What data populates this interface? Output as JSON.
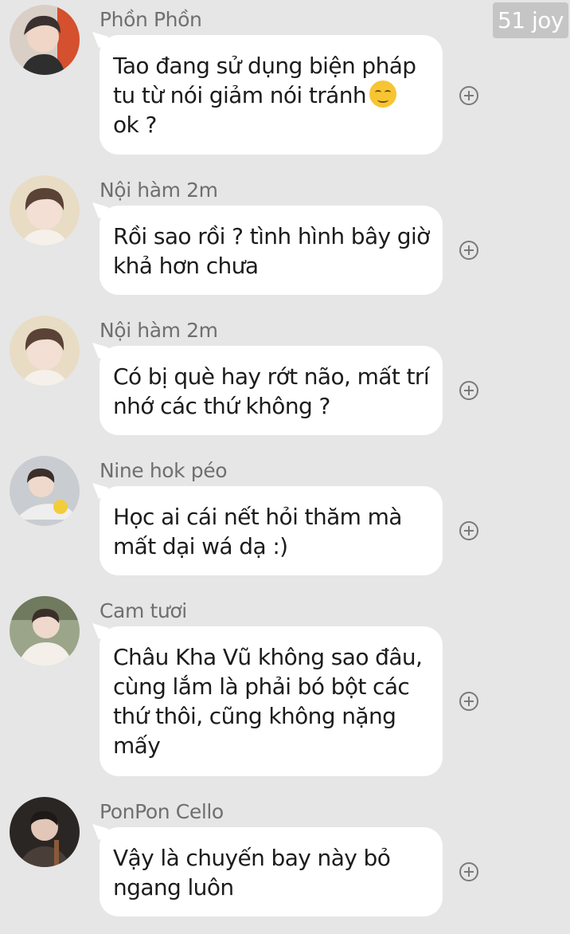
{
  "watermark": "51 joy",
  "messages": [
    {
      "sender": "Phồn Phồn",
      "lines": [
        "Tao đang sử dụng biện pháp",
        "tu từ nói giảm nói tránh",
        "ok ?"
      ],
      "emoji": "relieved-face"
    },
    {
      "sender": "Nội hàm 2m",
      "lines": [
        "Rồi sao rồi ? tình hình bây giờ",
        "khả hơn chưa"
      ]
    },
    {
      "sender": "Nội hàm 2m",
      "lines": [
        "Có bị què hay rớt não, mất trí",
        "nhớ các thứ không ?"
      ]
    },
    {
      "sender": "Nine hok péo",
      "lines": [
        "Học ai cái nết hỏi thăm mà",
        "mất dại wá dạ :)"
      ]
    },
    {
      "sender": "Cam tươi",
      "lines": [
        "Châu Kha Vũ không sao đâu,",
        "cùng lắm là phải bó bột các",
        "thứ thôi, cũng không nặng",
        "mấy"
      ]
    },
    {
      "sender": "PonPon Cello",
      "lines": [
        "Vậy là chuyến bay này bỏ",
        "ngang luôn"
      ]
    }
  ],
  "icons": {
    "add": "add-circle-icon",
    "avatar": "avatar"
  },
  "colors": {
    "background": "#e6e6e6",
    "bubble": "#ffffff",
    "name": "#6f6f6f"
  }
}
